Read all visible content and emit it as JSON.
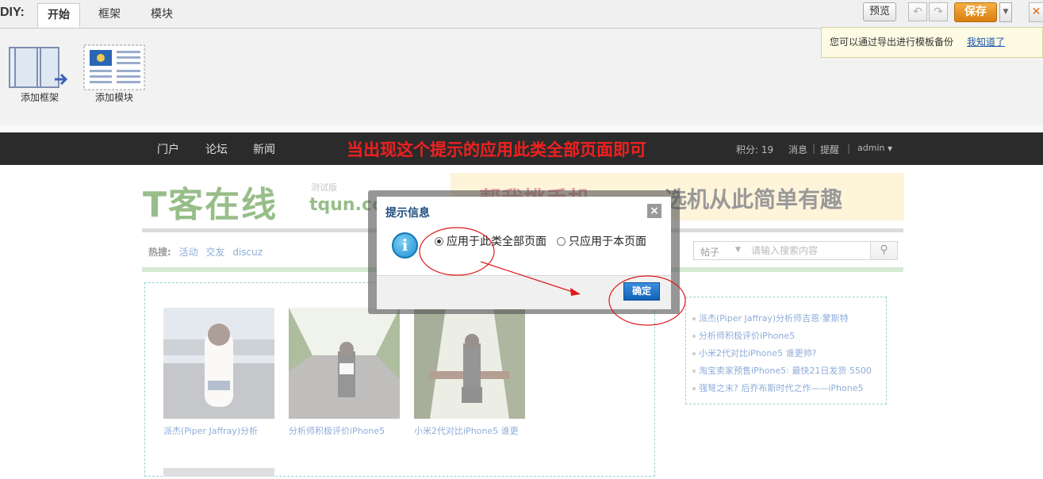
{
  "diy": {
    "label": "DIY:",
    "tabs": [
      "开始",
      "框架",
      "模块"
    ],
    "preview_label": "预览",
    "undo_icon": "undo-icon",
    "redo_icon": "redo-icon",
    "save_label": "保存",
    "close_glyph": "✕",
    "tip_text": "您可以通过导出进行模板备份",
    "tip_link": "我知道了",
    "tools": [
      {
        "label": "添加框架",
        "icon": "add-frame-icon"
      },
      {
        "label": "添加模块",
        "icon": "add-module-icon"
      }
    ]
  },
  "nav": {
    "items": [
      "门户",
      "论坛",
      "新闻"
    ],
    "annotation": "当出现这个提示的应用此类全部页面即可",
    "credits": "积分: 19",
    "messages": "消息",
    "reminders": "提醒",
    "user": "admin"
  },
  "site": {
    "logo_text": "T客在线",
    "logo_badge": "测试版",
    "logo_url": "tqun.com",
    "banner_left": "帮我挑手机",
    "banner_right": "选机从此简单有趣",
    "hot_label": "热搜:",
    "hot_tags": [
      "活动",
      "交友",
      "discuz"
    ],
    "search_type": "帖子",
    "search_placeholder": "请输入搜索内容",
    "search_icon": "search-icon"
  },
  "thumbs": [
    {
      "caption": "派杰(Piper Jaffray)分析"
    },
    {
      "caption": "分析师积极评价iPhone5"
    },
    {
      "caption": "小米2代对比iPhone5 谁更"
    }
  ],
  "sidebar_list": [
    "派杰(Piper Jaffray)分析师吉恩·蒙斯特",
    "分析师积极评价iPhone5",
    "小米2代对比iPhone5 谁更帅?",
    "淘宝卖家预售iPhone5: 最快21日发货 5500",
    "强弩之末? 后乔布斯时代之作——iPhone5"
  ],
  "dialog": {
    "title": "提示信息",
    "close_glyph": "×",
    "info_glyph": "i",
    "options": [
      {
        "label": "应用于此类全部页面",
        "selected": true
      },
      {
        "label": "只应用于本页面",
        "selected": false
      }
    ],
    "ok_label": "确定"
  },
  "colors": {
    "accent_save": "#e08a1b",
    "dialog_title": "#1d4c7e",
    "annotation_red": "#f02020",
    "ok_button": "#1f6fc5"
  }
}
